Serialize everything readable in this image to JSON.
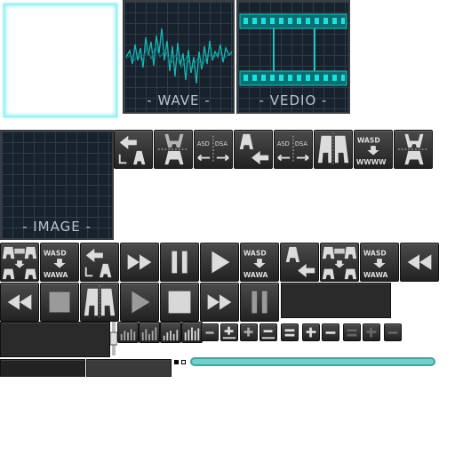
{
  "panels": {
    "wave_label": "- WAVE -",
    "video_label": "- VEDIO -",
    "image_label": "- IMAGE -"
  },
  "icons": {
    "row1": [
      "turn-left-icon",
      "flip-vertical-icon",
      "asd-dsa-icon",
      "turn-right-icon",
      "asd-dsa-icon",
      "split-aa-icon",
      "wasd-wwww-icon",
      "flip-vertical-icon"
    ],
    "row2": [
      "aa-grid-icon",
      "wasd-wawa-icon",
      "turn-left-icon",
      "fast-forward-icon",
      "pause-icon",
      "play-icon",
      "wasd-wawa-icon",
      "turn-right-icon",
      "aa-grid-icon",
      "wasd-wawa-icon",
      "rewind-icon"
    ],
    "row3": [
      "rewind-icon",
      "stop-icon",
      "split-aa-icon",
      "play-icon",
      "stop-icon",
      "fast-forward-icon",
      "pause-icon"
    ]
  },
  "text": {
    "asd": "ASD",
    "dsa": "DSA",
    "wasd": "WASD",
    "wwww": "WWWW",
    "wawa": "WAWA"
  },
  "colors": {
    "accent": "#6fd0cc",
    "wave": "#19b8b8",
    "panel_bg": "#18222c"
  }
}
